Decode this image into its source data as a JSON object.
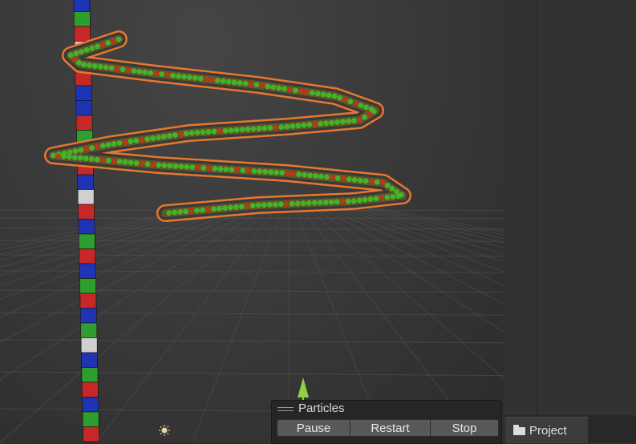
{
  "scene": {
    "colors": {
      "grid": "#555555",
      "particle_outline": "#e8772e",
      "particle_green": "#3fbf2a",
      "particle_red": "#c2351e",
      "cube_colors": [
        "#1f34b5",
        "#c62828",
        "#2e9e2e",
        "#d0d0d0"
      ],
      "gizmo_arrow": "#8fd13f"
    },
    "icons": [
      "directional-light-icon",
      "y-axis-gizmo-arrow-icon"
    ]
  },
  "particles_panel": {
    "title": "Particles",
    "buttons": {
      "pause": "Pause",
      "restart": "Restart",
      "stop": "Stop"
    }
  },
  "project_panel": {
    "tab_label": "Project",
    "tab_icon": "folder-icon"
  }
}
